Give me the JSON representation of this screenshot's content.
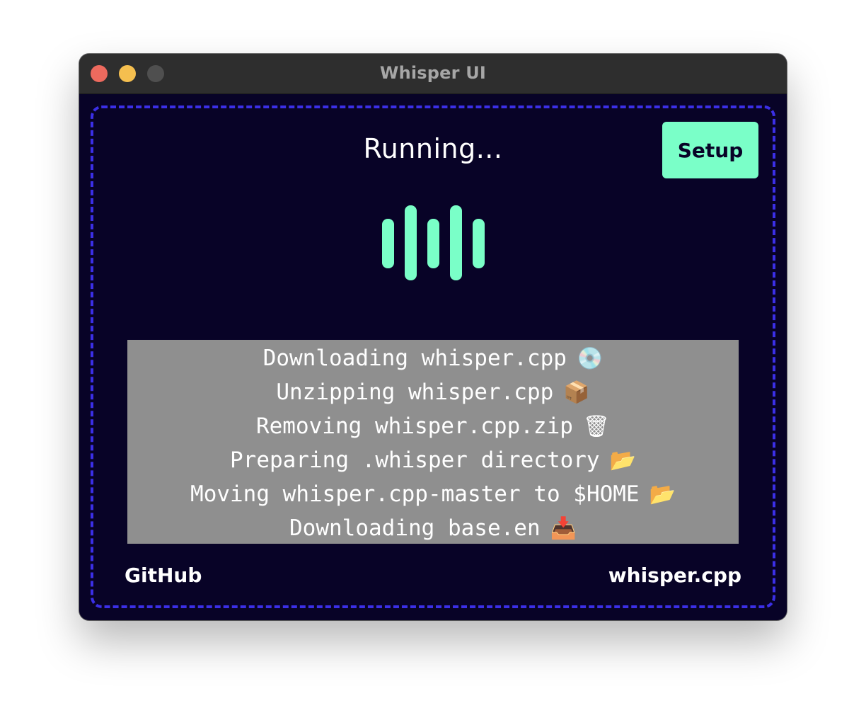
{
  "window": {
    "title": "Whisper UI"
  },
  "main": {
    "status_text": "Running...",
    "setup_button_label": "Setup",
    "waveform_icon": "audio-waveform-icon",
    "accent_color": "#7affc8",
    "background_color": "#080327",
    "dropzone_border_color": "#3b2fe6"
  },
  "log": {
    "lines": [
      {
        "text": "Downloading whisper.cpp",
        "emoji": "💿",
        "icon": "dvd-icon"
      },
      {
        "text": "Unzipping whisper.cpp",
        "emoji": "📦",
        "icon": "package-icon"
      },
      {
        "text": "Removing whisper.cpp.zip",
        "emoji": "🗑",
        "icon": "wastebasket-icon"
      },
      {
        "text": "Preparing .whisper directory",
        "emoji": "📂",
        "icon": "open-folder-icon"
      },
      {
        "text": "Moving whisper.cpp-master to $HOME",
        "emoji": "📂",
        "icon": "open-folder-icon"
      },
      {
        "text": "Downloading base.en",
        "emoji": "📥",
        "icon": "inbox-tray-icon"
      }
    ]
  },
  "footer": {
    "left_link": "GitHub",
    "right_link": "whisper.cpp"
  }
}
